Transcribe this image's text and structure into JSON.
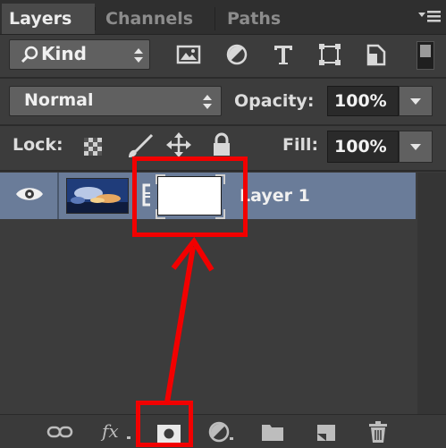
{
  "tabs": [
    {
      "label": "Layers",
      "active": true
    },
    {
      "label": "Channels",
      "active": false
    },
    {
      "label": "Paths",
      "active": false
    }
  ],
  "filter": {
    "kind_label": "Kind",
    "icons": [
      "pixel-layer-filter-icon",
      "adjustment-layer-filter-icon",
      "type-layer-filter-icon",
      "shape-layer-filter-icon",
      "smart-object-filter-icon"
    ]
  },
  "blend": {
    "mode": "Normal",
    "opacity_label": "Opacity:",
    "opacity_value": "100%"
  },
  "lock": {
    "label": "Lock:",
    "fill_label": "Fill:",
    "fill_value": "100%"
  },
  "layers": [
    {
      "name": "Layer 1",
      "visible": true,
      "selected": true,
      "has_mask": true
    }
  ],
  "bottom_icons": [
    "link-layers-icon",
    "fx-icon",
    "add-layer-mask-icon",
    "adjustment-layer-icon",
    "new-group-folder-icon",
    "new-layer-icon",
    "trash-icon"
  ],
  "fx_text": "fx",
  "colors": {
    "panel_bg": "#3c3c3c",
    "selected_row": "#6a7c99",
    "annotation_red": "#f20000"
  }
}
